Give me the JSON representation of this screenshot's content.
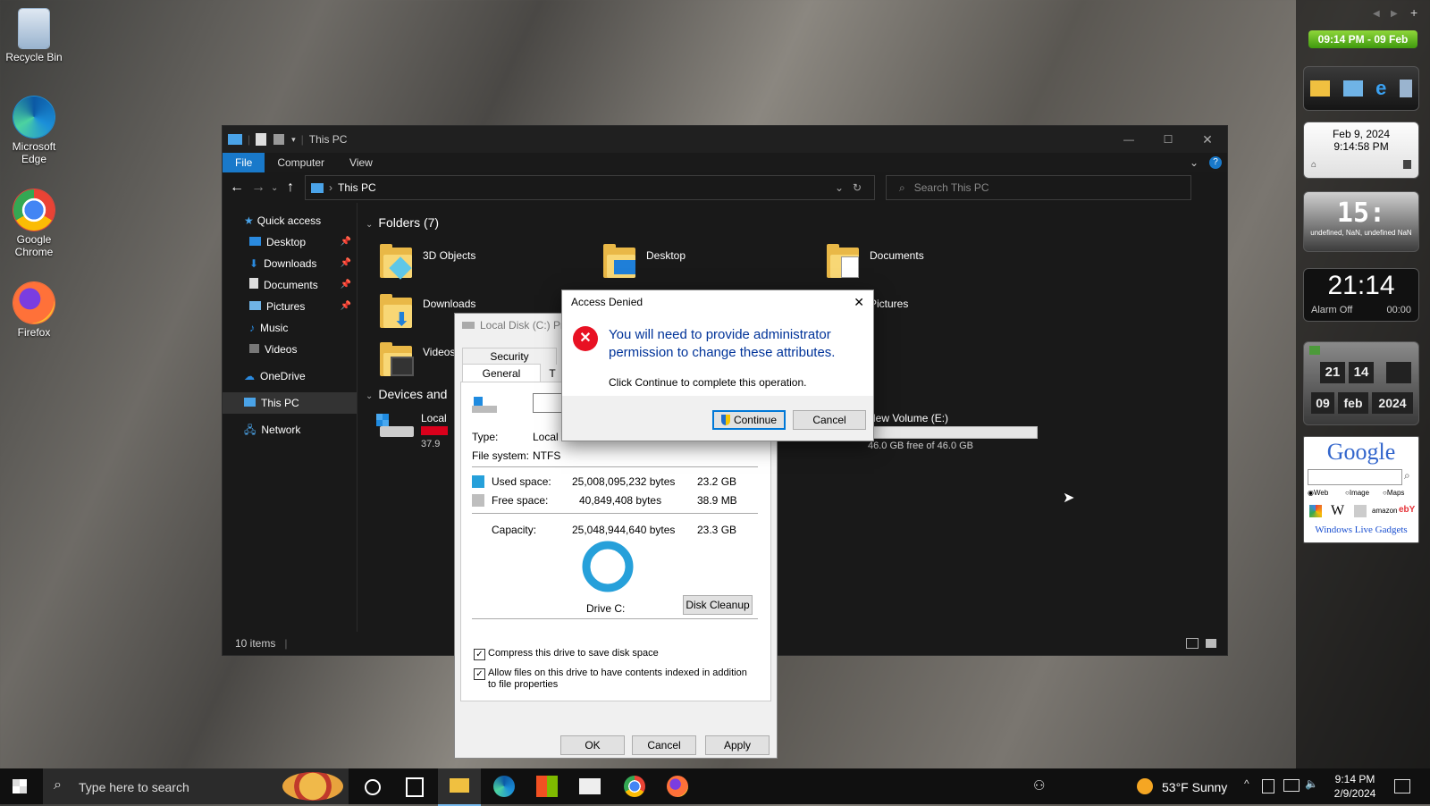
{
  "desktop": {
    "icons": [
      {
        "label": "Recycle Bin",
        "color": "#9ab4cf"
      },
      {
        "label": "Microsoft Edge",
        "color": "#1b8fd9"
      },
      {
        "label": "Google Chrome",
        "color": "#e8453c"
      },
      {
        "label": "Firefox",
        "color": "#ff7139"
      }
    ]
  },
  "explorer": {
    "title": "This PC",
    "ribbon": {
      "file": "File",
      "computer": "Computer",
      "view": "View"
    },
    "address": "This PC",
    "search_placeholder": "Search This PC",
    "nav": {
      "quick_access": "Quick access",
      "items": [
        "Desktop",
        "Downloads",
        "Documents",
        "Pictures",
        "Music",
        "Videos"
      ],
      "onedrive": "OneDrive",
      "this_pc": "This PC",
      "network": "Network"
    },
    "folders_header": "Folders (7)",
    "folders": [
      "3D Objects",
      "Desktop",
      "Documents",
      "Downloads",
      "Pictures",
      "Videos"
    ],
    "devices_header": "Devices and",
    "drive_local_label": "Local",
    "drive_local_free": "37.9",
    "drive_e": {
      "label": "New Volume (E:)",
      "free": "46.0 GB free of 46.0 GB",
      "fill": 0.0
    },
    "status": "10 items"
  },
  "props": {
    "title": "Local Disk (C:) Pro",
    "tabs": {
      "security": "Security",
      "general": "General",
      "other": "T"
    },
    "type_label": "Type:",
    "type_value": "Local Disk",
    "fs_label": "File system:",
    "fs_value": "NTFS",
    "used_label": "Used space:",
    "used_bytes": "25,008,095,232 bytes",
    "used_size": "23.2 GB",
    "free_label": "Free space:",
    "free_bytes": "40,849,408 bytes",
    "free_size": "38.9 MB",
    "cap_label": "Capacity:",
    "cap_bytes": "25,048,944,640 bytes",
    "cap_size": "23.3 GB",
    "drive_label": "Drive C:",
    "disk_cleanup": "Disk Cleanup",
    "compress": "Compress this drive to save disk space",
    "index": "Allow files on this drive to have contents indexed in addition to file properties",
    "ok": "OK",
    "cancel": "Cancel",
    "apply": "Apply",
    "used_color": "#26a0da",
    "free_color": "#bebebe"
  },
  "dialog": {
    "title": "Access Denied",
    "message": "You will need to provide administrator permission to change these attributes.",
    "sub": "Click Continue to complete this operation.",
    "continue": "Continue",
    "cancel": "Cancel",
    "message_color": "#003399"
  },
  "gadgets": {
    "topclock": "09:14 PM - 09 Feb",
    "date": "Feb 9, 2024",
    "time": "9:14:58 PM",
    "digital": "15:",
    "digital_sub": "undefined, NaN, undefined NaN",
    "alarm_time": "21:14",
    "alarm_off": "Alarm Off",
    "alarm_timer": "00:00",
    "flip_time": [
      "21",
      "14"
    ],
    "flip_date": [
      "09",
      "feb",
      "2024"
    ],
    "google": "Google",
    "radio": [
      "Web",
      "Image",
      "Maps"
    ],
    "wlg": "Windows Live Gadgets"
  },
  "taskbar": {
    "search_placeholder": "Type here to search",
    "weather": "53°F  Sunny",
    "time": "9:14 PM",
    "date": "2/9/2024"
  }
}
